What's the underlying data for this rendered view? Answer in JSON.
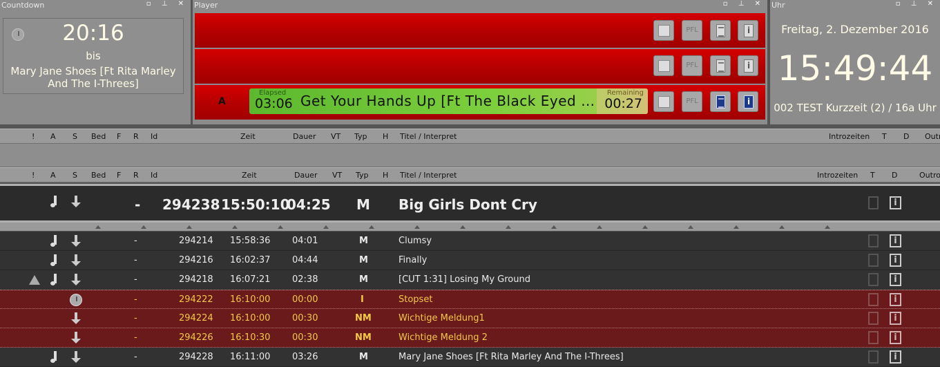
{
  "countdown": {
    "title": "Countdown",
    "time": "20:16",
    "bis": "bis",
    "song": "Mary Jane Shoes [Ft Rita Marley And The I-Threes]"
  },
  "panel_buttons": "▫ ⊥ ✕",
  "player": {
    "title": "Player",
    "pfl_label": "PFL",
    "lane3_letter": "A",
    "elapsed_label": "Elapsed",
    "elapsed": "03:06",
    "track_title": "Get Your Hands Up [Ft The Black Eyed Peas]",
    "remaining_label": "Remaining",
    "remaining": "00:27"
  },
  "uhr": {
    "title": "Uhr",
    "date": "Freitag, 2. Dezember 2016",
    "time": "15:49:44",
    "info": "002 TEST Kurzzeit (2) / 16a Uhr"
  },
  "columns": {
    "excl": "!",
    "a": "A",
    "s": "S",
    "bed": "Bed",
    "f": "F",
    "r": "R",
    "id": "Id",
    "zeit": "Zeit",
    "dauer": "Dauer",
    "vt": "VT",
    "typ": "Typ",
    "h": "H",
    "titel": "Titel / Interpret",
    "intro": "Introzeiten",
    "t": "T",
    "d": "D",
    "outro": "Outro"
  },
  "now_playing": {
    "r": "-",
    "id": "294238",
    "zeit": "15:50:10",
    "dauer": "04:25",
    "typ": "M",
    "titel": "Big Girls Dont Cry"
  },
  "rows": [
    {
      "r": "-",
      "id": "294214",
      "zeit": "15:58:36",
      "dauer": "04:01",
      "typ": "M",
      "titel": "Clumsy",
      "info": "i"
    },
    {
      "r": "-",
      "id": "294216",
      "zeit": "16:02:37",
      "dauer": "04:44",
      "typ": "M",
      "titel": "Finally",
      "info": "i"
    },
    {
      "r": "-",
      "id": "294218",
      "zeit": "16:07:21",
      "dauer": "02:38",
      "typ": "M",
      "titel": "[CUT 1:31] Losing My Ground",
      "info": "i"
    },
    {
      "r": "-",
      "id": "294222",
      "zeit": "16:10:00",
      "dauer": "00:00",
      "typ": "I",
      "titel": "Stopset",
      "info": "i"
    },
    {
      "r": "-",
      "id": "294224",
      "zeit": "16:10:00",
      "dauer": "00:30",
      "typ": "NM",
      "titel": "Wichtige Meldung1",
      "info": "i"
    },
    {
      "r": "-",
      "id": "294226",
      "zeit": "16:10:30",
      "dauer": "00:30",
      "typ": "NM",
      "titel": "Wichtige Meldung 2",
      "info": "i"
    },
    {
      "r": "-",
      "id": "294228",
      "zeit": "16:11:00",
      "dauer": "03:26",
      "typ": "M",
      "titel": "Mary Jane Shoes [Ft Rita Marley And The I-Threes]",
      "info": "i"
    }
  ],
  "info_glyph": "i",
  "colors": {
    "lane_red": "#c00000",
    "stopset_row": "#6a1a1a",
    "stopset_text": "#f2c84a",
    "waveform_green": "#6cc436"
  }
}
